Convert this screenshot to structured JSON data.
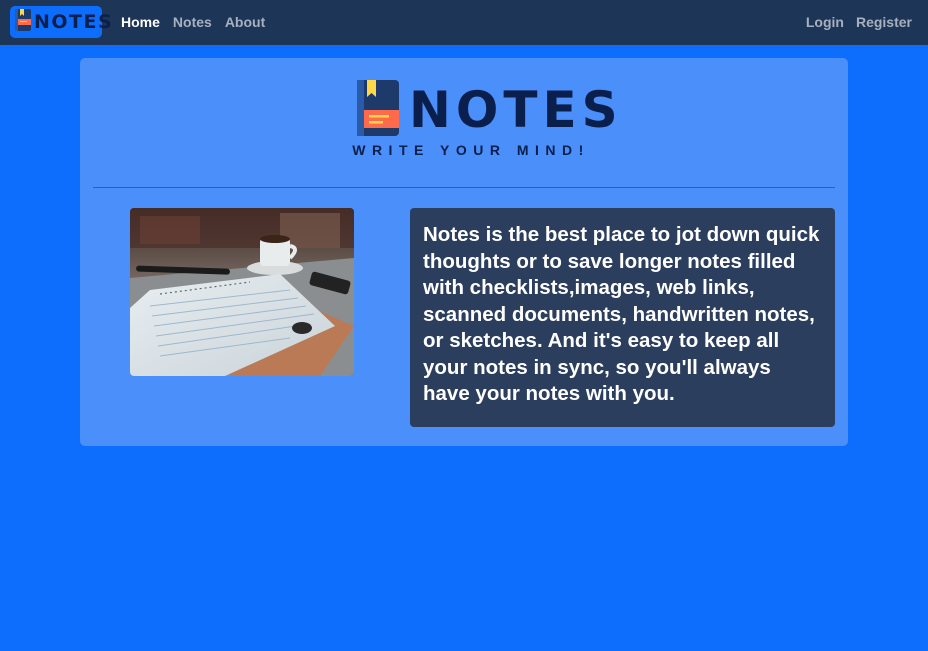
{
  "navbar": {
    "brand_text": "NOTES",
    "links": [
      {
        "label": "Home",
        "active": true
      },
      {
        "label": "Notes",
        "active": false
      },
      {
        "label": "About",
        "active": false
      }
    ],
    "auth": {
      "login": "Login",
      "register": "Register"
    }
  },
  "hero": {
    "title": "NOTES",
    "tagline": "WRITE YOUR MIND!"
  },
  "content": {
    "image_alt": "notebook and coffee cup",
    "description": "Notes is the best place to jot down quick thoughts or to save longer notes filled with checklists,images, web links, scanned documents, handwritten notes, or sketches. And it's easy to keep all your notes in sync, so you'll always have your notes with you."
  },
  "colors": {
    "page_bg": "#0d6efd",
    "navbar_bg": "#1d3557",
    "card_bg": "#4b8ffa",
    "text_panel_bg": "#2c3e5e",
    "logo_dark": "#0b1f4d",
    "logo_accent": "#ff6b4a"
  },
  "icons": {
    "brand_logo": "notebook-icon"
  }
}
